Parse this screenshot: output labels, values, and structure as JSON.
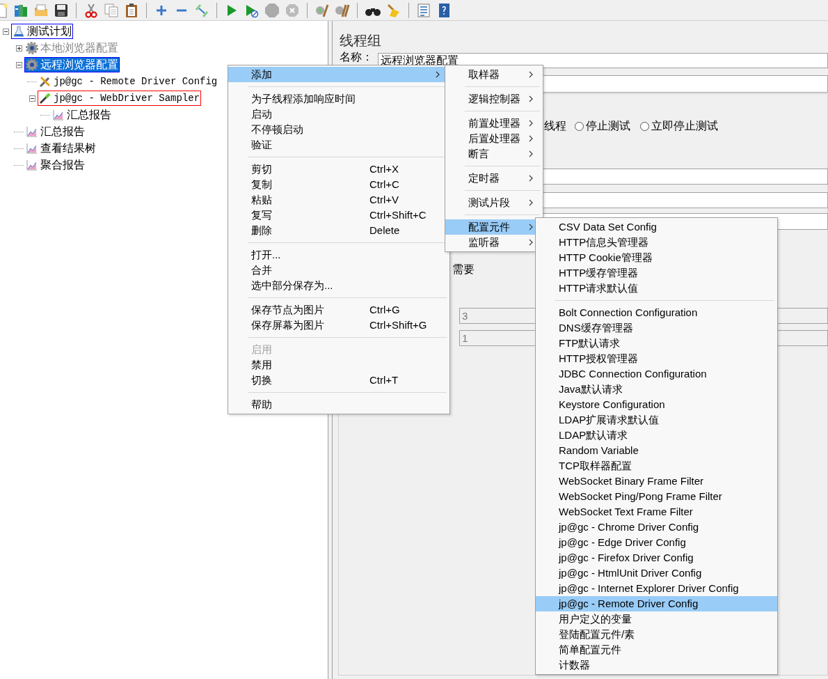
{
  "tree": [
    {
      "label": "测试计划",
      "kind": "test_plan",
      "expanded": true,
      "selected": false,
      "color": "#0000ff",
      "children": [
        {
          "label": "本地浏览器配置",
          "kind": "config",
          "expanded": false,
          "disabled": true,
          "selected": false
        },
        {
          "label": "远程浏览器配置",
          "kind": "config",
          "expanded": true,
          "selected": true,
          "color": "#0000ff",
          "children": [
            {
              "label": "jp@gc - Remote Driver Config",
              "kind": "tool",
              "selected": false
            },
            {
              "label": "jp@gc - WebDriver Sampler",
              "kind": "sampler",
              "expanded": true,
              "selected": false,
              "color": "#ff0000",
              "children": [
                {
                  "label": "汇总报告",
                  "kind": "listener",
                  "selected": false
                }
              ]
            }
          ]
        },
        {
          "label": "汇总报告",
          "kind": "listener",
          "selected": false
        },
        {
          "label": "查看结果树",
          "kind": "listener",
          "selected": false
        },
        {
          "label": "聚合报告",
          "kind": "listener",
          "selected": false
        }
      ]
    }
  ],
  "panel": {
    "title": "线程组",
    "name_label": "名称：",
    "name_value": "远程浏览器配置",
    "options": [
      {
        "label": "线程"
      },
      {
        "label": "停止测试",
        "selected": false
      },
      {
        "label": "立即停止测试",
        "selected": false
      }
    ],
    "note": "需要",
    "fields": [
      "3",
      "1"
    ]
  },
  "menus": [
    {
      "items": [
        {
          "kind": "item",
          "label": "添加",
          "submenu": true,
          "selected": true
        },
        {
          "kind": "separator"
        },
        {
          "kind": "item",
          "label": "为子线程添加响应时间"
        },
        {
          "kind": "item",
          "label": "启动"
        },
        {
          "kind": "item",
          "label": "不停顿启动"
        },
        {
          "kind": "item",
          "label": "验证"
        },
        {
          "kind": "separator"
        },
        {
          "kind": "item",
          "label": "剪切",
          "shortcut": "Ctrl+X"
        },
        {
          "kind": "item",
          "label": "复制",
          "shortcut": "Ctrl+C"
        },
        {
          "kind": "item",
          "label": "粘贴",
          "shortcut": "Ctrl+V"
        },
        {
          "kind": "item",
          "label": "复写",
          "shortcut": "Ctrl+Shift+C"
        },
        {
          "kind": "item",
          "label": "删除",
          "shortcut": "Delete"
        },
        {
          "kind": "separator"
        },
        {
          "kind": "item",
          "label": "打开..."
        },
        {
          "kind": "item",
          "label": "合并"
        },
        {
          "kind": "item",
          "label": "选中部分保存为..."
        },
        {
          "kind": "separator"
        },
        {
          "kind": "item",
          "label": "保存节点为图片",
          "shortcut": "Ctrl+G"
        },
        {
          "kind": "item",
          "label": "保存屏幕为图片",
          "shortcut": "Ctrl+Shift+G"
        },
        {
          "kind": "separator"
        },
        {
          "kind": "item",
          "label": "启用",
          "disabled": true
        },
        {
          "kind": "item",
          "label": "禁用"
        },
        {
          "kind": "item",
          "label": "切换",
          "shortcut": "Ctrl+T"
        },
        {
          "kind": "separator"
        },
        {
          "kind": "item",
          "label": "帮助"
        }
      ]
    },
    {
      "items": [
        {
          "kind": "item",
          "label": "取样器",
          "submenu": true
        },
        {
          "kind": "separator"
        },
        {
          "kind": "item",
          "label": "逻辑控制器",
          "submenu": true
        },
        {
          "kind": "separator"
        },
        {
          "kind": "item",
          "label": "前置处理器",
          "submenu": true
        },
        {
          "kind": "item",
          "label": "后置处理器",
          "submenu": true
        },
        {
          "kind": "item",
          "label": "断言",
          "submenu": true
        },
        {
          "kind": "separator"
        },
        {
          "kind": "item",
          "label": "定时器",
          "submenu": true
        },
        {
          "kind": "separator"
        },
        {
          "kind": "item",
          "label": "测试片段",
          "submenu": true
        },
        {
          "kind": "separator"
        },
        {
          "kind": "item",
          "label": "配置元件",
          "submenu": true,
          "selected": true
        },
        {
          "kind": "item",
          "label": "监听器",
          "submenu": true
        }
      ]
    },
    {
      "items": [
        {
          "kind": "item",
          "label": "CSV Data Set Config"
        },
        {
          "kind": "item",
          "label": "HTTP信息头管理器"
        },
        {
          "kind": "item",
          "label": "HTTP Cookie管理器"
        },
        {
          "kind": "item",
          "label": "HTTP缓存管理器"
        },
        {
          "kind": "item",
          "label": "HTTP请求默认值"
        },
        {
          "kind": "separator"
        },
        {
          "kind": "item",
          "label": "Bolt Connection Configuration"
        },
        {
          "kind": "item",
          "label": "DNS缓存管理器"
        },
        {
          "kind": "item",
          "label": "FTP默认请求"
        },
        {
          "kind": "item",
          "label": "HTTP授权管理器"
        },
        {
          "kind": "item",
          "label": "JDBC Connection Configuration"
        },
        {
          "kind": "item",
          "label": "Java默认请求"
        },
        {
          "kind": "item",
          "label": "Keystore Configuration"
        },
        {
          "kind": "item",
          "label": "LDAP扩展请求默认值"
        },
        {
          "kind": "item",
          "label": "LDAP默认请求"
        },
        {
          "kind": "item",
          "label": "Random Variable"
        },
        {
          "kind": "item",
          "label": "TCP取样器配置"
        },
        {
          "kind": "item",
          "label": "WebSocket Binary Frame Filter"
        },
        {
          "kind": "item",
          "label": "WebSocket Ping/Pong Frame Filter"
        },
        {
          "kind": "item",
          "label": "WebSocket Text Frame Filter"
        },
        {
          "kind": "item",
          "label": "jp@gc - Chrome Driver Config"
        },
        {
          "kind": "item",
          "label": "jp@gc - Edge Driver Config"
        },
        {
          "kind": "item",
          "label": "jp@gc - Firefox Driver Config"
        },
        {
          "kind": "item",
          "label": "jp@gc - HtmlUnit Driver Config"
        },
        {
          "kind": "item",
          "label": "jp@gc - Internet Explorer Driver Config"
        },
        {
          "kind": "item",
          "label": "jp@gc - Remote Driver Config",
          "selected": true
        },
        {
          "kind": "item",
          "label": "用户定义的变量"
        },
        {
          "kind": "item",
          "label": "登陆配置元件/素"
        },
        {
          "kind": "item",
          "label": "简单配置元件"
        },
        {
          "kind": "item",
          "label": "计数器"
        }
      ]
    }
  ]
}
